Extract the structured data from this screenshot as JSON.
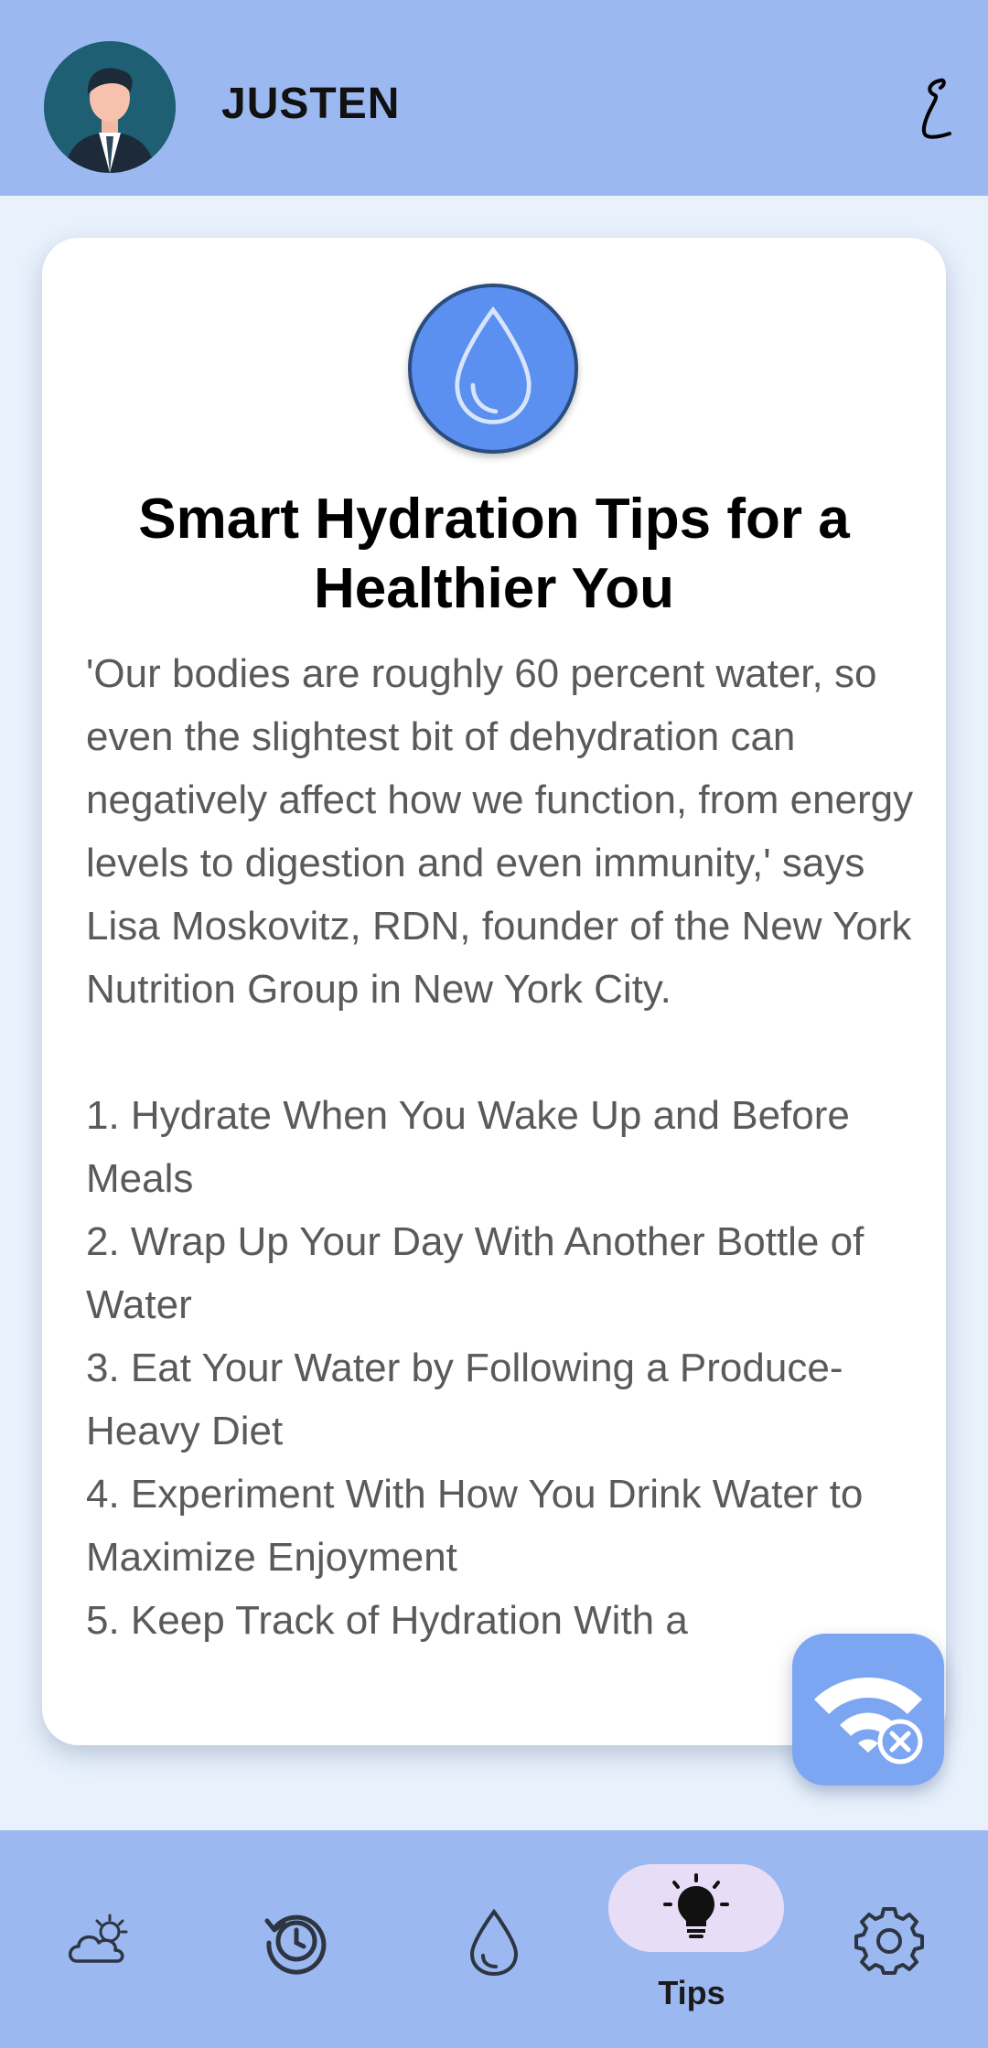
{
  "header": {
    "username": "JUSTEN",
    "avatar_icon": "businessman-avatar",
    "action_icon": "scribble-icon"
  },
  "card": {
    "icon": "water-drop-icon",
    "title": "Smart Hydration Tips for a Healthier You",
    "body": "'Our bodies are roughly 60 percent water, so even the slightest bit of dehydration can negatively affect how we function, from energy levels to digestion and even immunity,' says Lisa Moskovitz, RDN, founder of the New York Nutrition Group in New York City.\n\n1. Hydrate When You Wake Up and Before Meals\n2. Wrap Up Your Day With Another Bottle of Water\n3. Eat Your Water by Following a Produce-Heavy Diet\n4. Experiment With How You Drink Water to Maximize Enjoyment\n5. Keep Track of Hydration With a"
  },
  "fab": {
    "icon": "wifi-off-icon"
  },
  "bottom_nav": {
    "items": [
      {
        "icon": "weather-icon",
        "label": ""
      },
      {
        "icon": "history-icon",
        "label": ""
      },
      {
        "icon": "water-drop-icon",
        "label": ""
      },
      {
        "icon": "lightbulb-icon",
        "label": "Tips",
        "active": true
      },
      {
        "icon": "settings-icon",
        "label": ""
      }
    ]
  },
  "colors": {
    "header_bg": "#9bb8f0",
    "page_bg": "#e8f1fc",
    "accent": "#5b8ff0",
    "active_pill": "#e8ddf6"
  }
}
